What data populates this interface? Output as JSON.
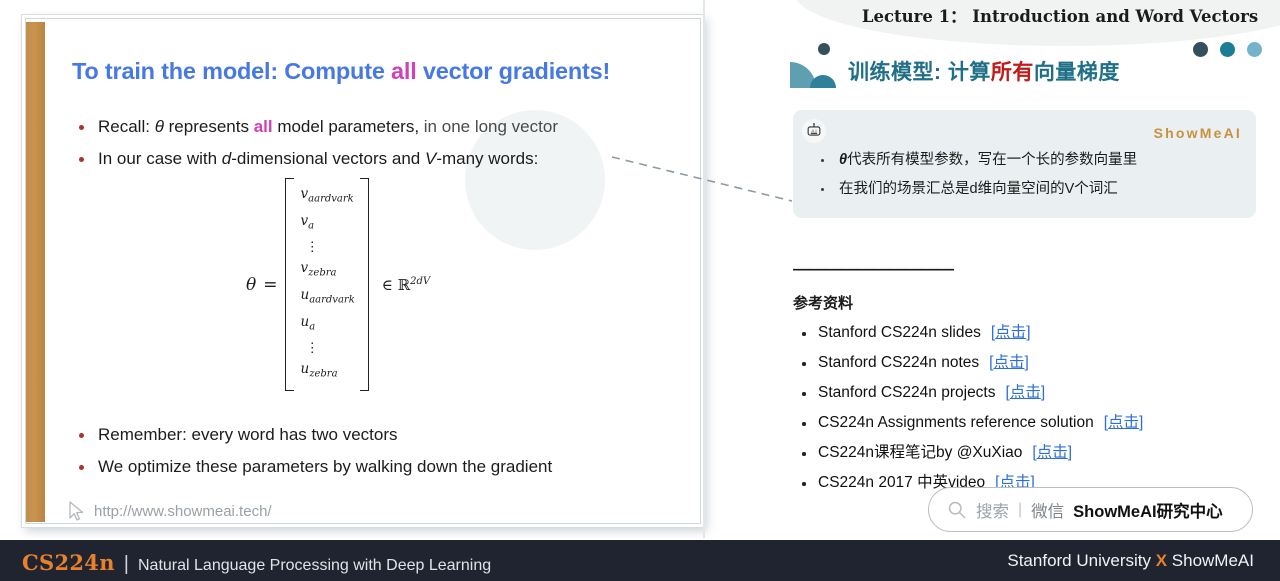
{
  "lecture": {
    "title": "Lecture 1： Introduction and Word Vectors"
  },
  "decor": {
    "dot_colors": [
      "#33505c",
      "#1c7d96",
      "#75b4c8"
    ],
    "shape_color": "#5e9fb1",
    "accent_teal": "#1f6f86"
  },
  "slide": {
    "title_prefix": "To train the model: Compute ",
    "title_highlight": "all",
    "title_suffix": " vector gradients!",
    "bullets": [
      {
        "parts": [
          {
            "text": "Recall: ",
            "style": "plain"
          },
          {
            "text": "θ",
            "style": "italic"
          },
          {
            "text": " represents ",
            "style": "plain"
          },
          {
            "text": "all",
            "style": "magenta"
          },
          {
            "text": " model parameters, ",
            "style": "plain"
          },
          {
            "text": "in one long vector",
            "style": "grey"
          }
        ]
      },
      {
        "parts": [
          {
            "text": "In our case with ",
            "style": "plain"
          },
          {
            "text": "d",
            "style": "italic"
          },
          {
            "text": "-dimensional vectors and ",
            "style": "plain"
          },
          {
            "text": "V",
            "style": "italic"
          },
          {
            "text": "-many words:",
            "style": "plain"
          }
        ]
      }
    ],
    "formula": {
      "lhs": "θ",
      "equals": "=",
      "rows": [
        "v_aardvark",
        "v_a",
        "⋮",
        "v_zebra",
        "u_aardvark",
        "u_a",
        "⋮",
        "u_zebra"
      ],
      "row_labels": [
        {
          "sym": "v",
          "sub": "aardvark"
        },
        {
          "sym": "v",
          "sub": "a"
        },
        {
          "sym": "⋮",
          "sub": ""
        },
        {
          "sym": "v",
          "sub": "zebra"
        },
        {
          "sym": "u",
          "sub": "aardvark"
        },
        {
          "sym": "u",
          "sub": "a"
        },
        {
          "sym": "⋮",
          "sub": ""
        },
        {
          "sym": "u",
          "sub": "zebra"
        }
      ],
      "membership": "∈ ℝ",
      "exponent": "2dV"
    },
    "bullets2": [
      {
        "text": "Remember: every word has two vectors"
      },
      {
        "text": "We optimize these parameters by walking down the gradient"
      }
    ],
    "url": "http://www.showmeai.tech/"
  },
  "card": {
    "brand": "ShowMeAI",
    "ai_badge": "A I",
    "items": [
      {
        "prefix": "θ",
        "text": "代表所有模型参数，写在一个长的参数向量里"
      },
      {
        "prefix": "",
        "text": "在我们的场景汇总是d维向量空间的V个词汇"
      }
    ]
  },
  "cn_title": {
    "before": "训练模型: 计算",
    "highlight": "所有",
    "after": "向量梯度"
  },
  "references": {
    "rule": "——————————",
    "heading": "参考资料",
    "link_label": "点击",
    "items": [
      {
        "label": "Stanford CS224n slides"
      },
      {
        "label": "Stanford CS224n notes"
      },
      {
        "label": "Stanford CS224n projects"
      },
      {
        "label": "CS224n Assignments reference solution"
      },
      {
        "label": "CS224n课程笔记by @XuXiao"
      },
      {
        "label": "CS224n 2017 中英video"
      }
    ]
  },
  "search": {
    "placeholder": "搜索",
    "separator": "|",
    "channel": "微信",
    "brand": "ShowMeAI研究中心"
  },
  "footer": {
    "course": "CS224n",
    "divider": "|",
    "subtitle": "Natural Language Processing with Deep Learning",
    "right_before": "Stanford University ",
    "right_x": "X",
    "right_after": " ShowMeAI",
    "accent": "#e8812c"
  }
}
